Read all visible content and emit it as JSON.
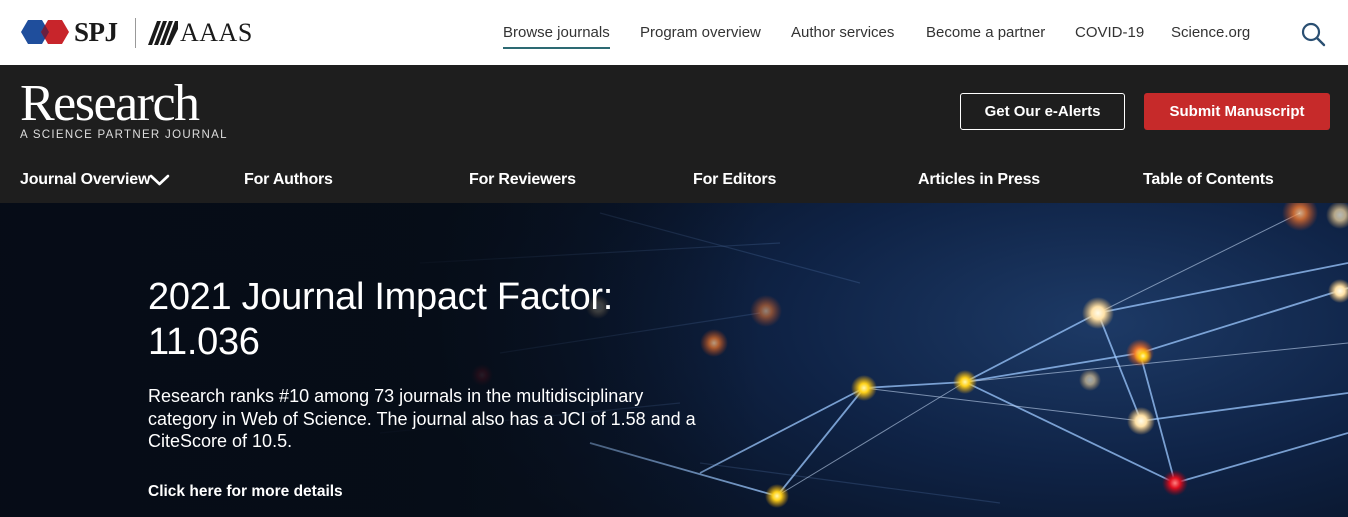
{
  "topbar": {
    "spj_logo_text": "SPJ",
    "aaas_logo_text": "AAAS",
    "nav": [
      "Browse journals",
      "Program overview",
      "Author services",
      "Become a partner",
      "COVID-19",
      "Science.org"
    ],
    "active_nav": "Browse journals",
    "search_icon": "search-icon"
  },
  "header": {
    "title": "Research",
    "subtitle": "A SCIENCE PARTNER JOURNAL",
    "alerts_button": "Get Our e-Alerts",
    "submit_button": "Submit Manuscript",
    "nav": [
      "Journal Overview",
      "For Authors",
      "For Reviewers",
      "For Editors",
      "Articles in Press",
      "Table of Contents"
    ],
    "dropdown_icon": "chevron-down-icon"
  },
  "hero": {
    "title_line1": "2021 Journal Impact Factor:",
    "title_line2": "11.036",
    "description": "Research ranks #10 among 73 journals in the multidisciplinary category in Web of Science. The journal also has a JCI of 1.58 and a CiteScore of 10.5.",
    "link": "Click here for more details"
  },
  "colors": {
    "dark_header": "#1e1e1e",
    "submit_red": "#c62a2a",
    "active_underline": "#2d6a73",
    "spj_blue": "#1f4e9c",
    "spj_red": "#c8252b"
  }
}
